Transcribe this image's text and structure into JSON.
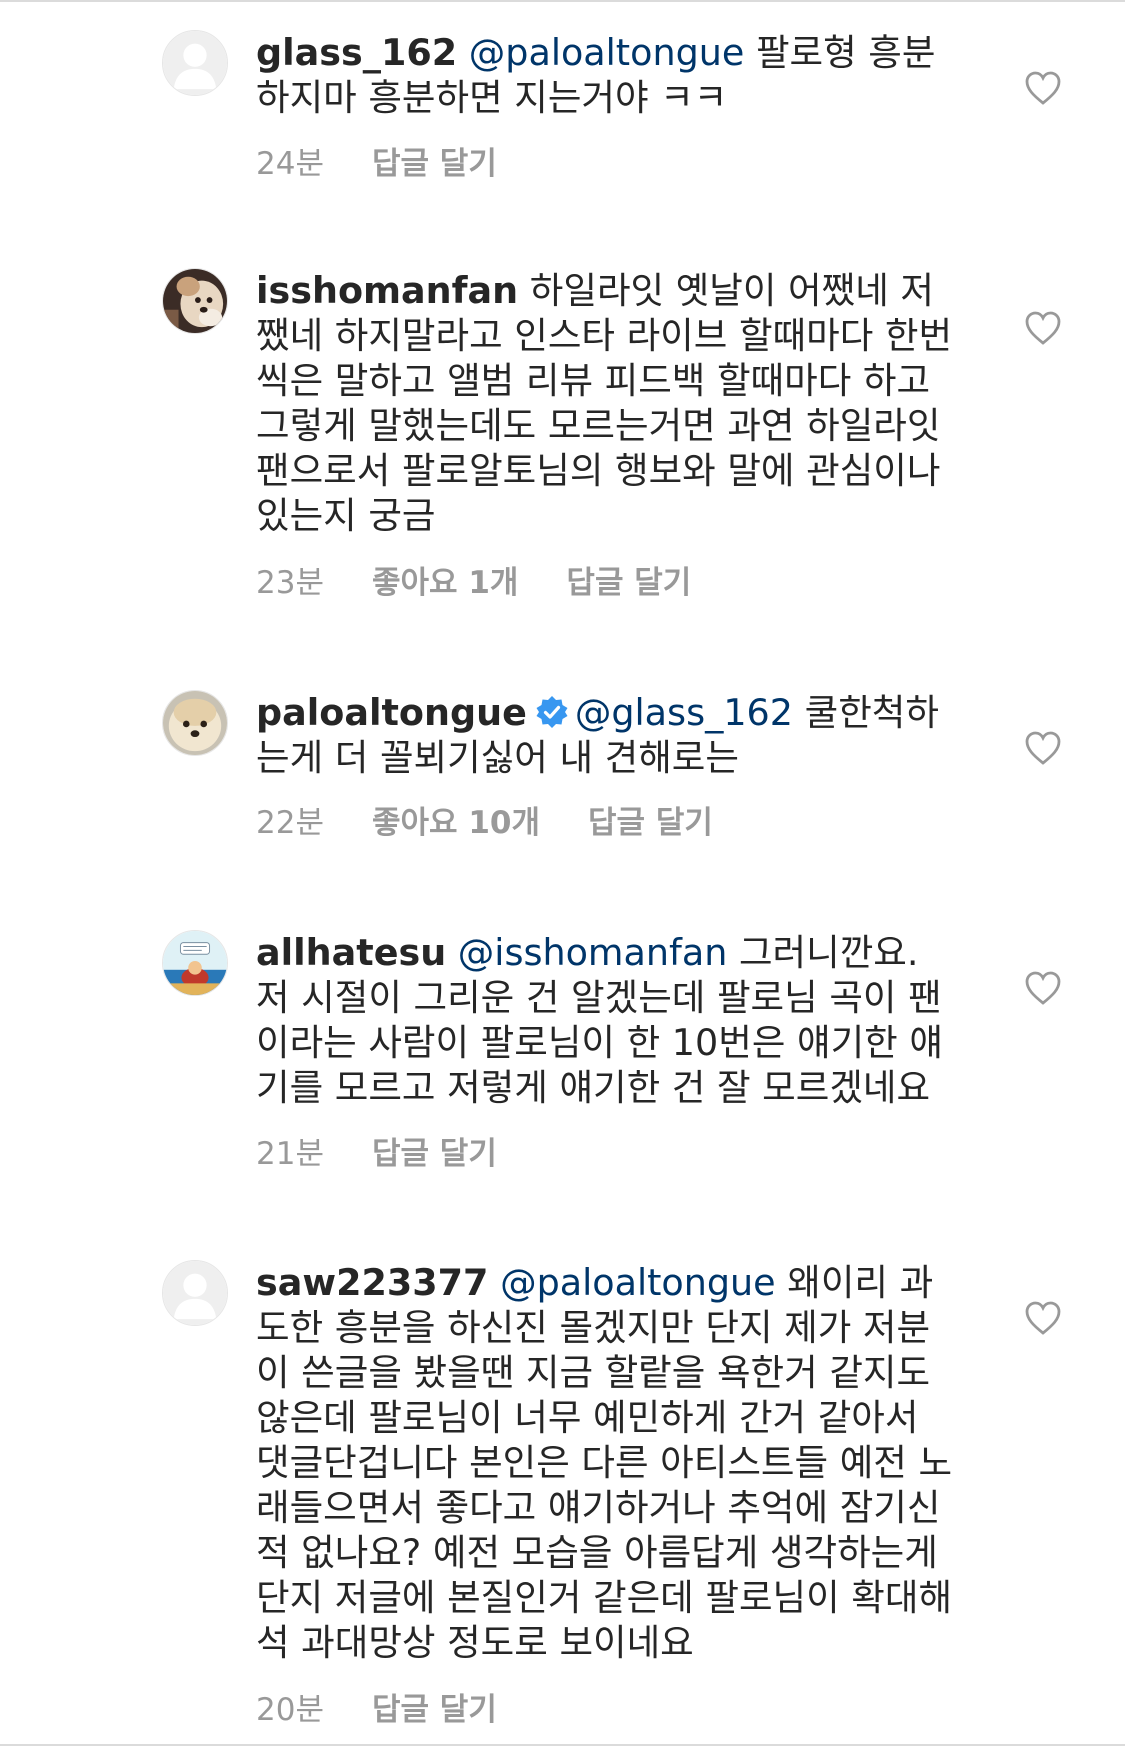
{
  "comments": [
    {
      "username": "glass_162",
      "mention": "@paloaltongue",
      "text": "팔로형 흥분하지마 흥분하면 지는거야 ㅋㅋ",
      "time": "24분",
      "likes": "",
      "reply": "답글 달기",
      "verified": false,
      "avatar": "default-avatar-icon"
    },
    {
      "username": "isshomanfan",
      "mention": "",
      "text": "하일라잇 옛날이 어쨌네 저쨌네 하지말라고 인스타 라이브 할때마다 한번씩은 말하고 앨범 리뷰 피드백 할때마다 하고 그렇게 말했는데도 모르는거면 과연 하일라잇 팬으로서 팔로알토님의 행보와 말에 관심이나 있는지 궁금",
      "time": "23분",
      "likes": "좋아요 1개",
      "reply": "답글 달기",
      "verified": false,
      "avatar": "dog-photo-avatar"
    },
    {
      "username": "paloaltongue",
      "mention": "@glass_162",
      "text": "쿨한척하는게 더 꼴뵈기싫어 내 견해로는",
      "time": "22분",
      "likes": "좋아요 10개",
      "reply": "답글 달기",
      "verified": true,
      "avatar": "dog-photo-avatar"
    },
    {
      "username": "allhatesu",
      "mention": "@isshomanfan",
      "text": "그러니깐요. 저 시절이 그리운 건 알겠는데 팔로님 곡이 팬이라는 사람이 팔로님이 한 10번은 얘기한 얘기를 모르고 저렇게 얘기한 건 잘 모르겠네요",
      "time": "21분",
      "likes": "",
      "reply": "답글 달기",
      "verified": false,
      "avatar": "illustration-avatar"
    },
    {
      "username": "saw223377",
      "mention": "@paloaltongue",
      "text": "왜이리 과도한 흥분을 하신진 몰겠지만 단지 제가 저분이 쓴글을 봤을땐 지금 할랕을 욕한거 같지도 않은데 팔로님이 너무 예민하게 간거 같아서 댓글단겁니다 본인은 다른 아티스트들 예전 노래들으면서 좋다고 얘기하거나 추억에 잠기신적 없나요? 예전 모습을 아름답게 생각하는게 단지 저글에 본질인거 같은데 팔로님이 확대해석 과대망상 정도로 보이네요",
      "time": "20분",
      "likes": "",
      "reply": "답글 달기",
      "verified": false,
      "avatar": "default-avatar-icon"
    }
  ],
  "colors": {
    "text": "#262626",
    "meta": "#999999",
    "mention": "#003569",
    "verified": "#3897f0",
    "divider": "#dbdbdb"
  }
}
